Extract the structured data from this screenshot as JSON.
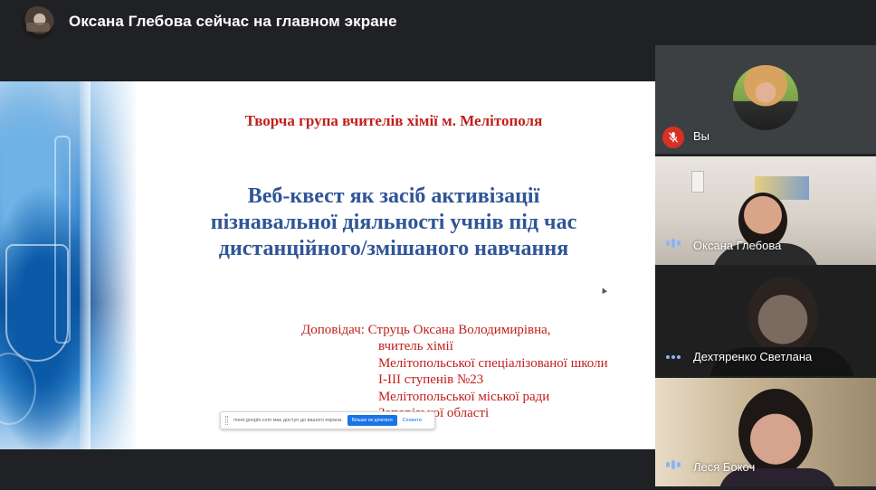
{
  "header": {
    "presenter_title": "Оксана Глебова сейчас на главном экране"
  },
  "slide": {
    "header": "Творча група  вчителів хімії м. Мелітополя",
    "title_lines": [
      "Веб-квест як засіб активізації",
      "пізнавальної діяльності учнів під час",
      "дистанційного/змішаного навчання"
    ],
    "speaker_label": "Доповідач: Струць Оксана Володимирівна,",
    "speaker_lines": [
      "вчитель хімії",
      "Мелітопольської спеціалізованої школи",
      "І-ІІІ ступенів №23",
      "Мелітопольської міської ради",
      "Запорізької області"
    ]
  },
  "share_notification": {
    "text": "meet.google.com має доступ до вашого екрана.",
    "stop_label": "Більше не ділитися",
    "hide_label": "Сховати"
  },
  "participants": [
    {
      "name": "Вы",
      "mic": "muted"
    },
    {
      "name": "Оксана Глебова",
      "mic": "speaking"
    },
    {
      "name": "Дехтяренко Светлана",
      "mic": "on"
    },
    {
      "name": "Леся Бокоч",
      "mic": "speaking"
    }
  ],
  "icons": {
    "mic_muted": "mic-off-icon",
    "audio": "audio-level-icon"
  },
  "colors": {
    "background": "#202124",
    "slide_header": "#c0201c",
    "slide_title": "#2f5597",
    "mic_muted": "#d93025",
    "audio_indicator": "#8ab4f8",
    "share_button": "#1a73e8"
  }
}
